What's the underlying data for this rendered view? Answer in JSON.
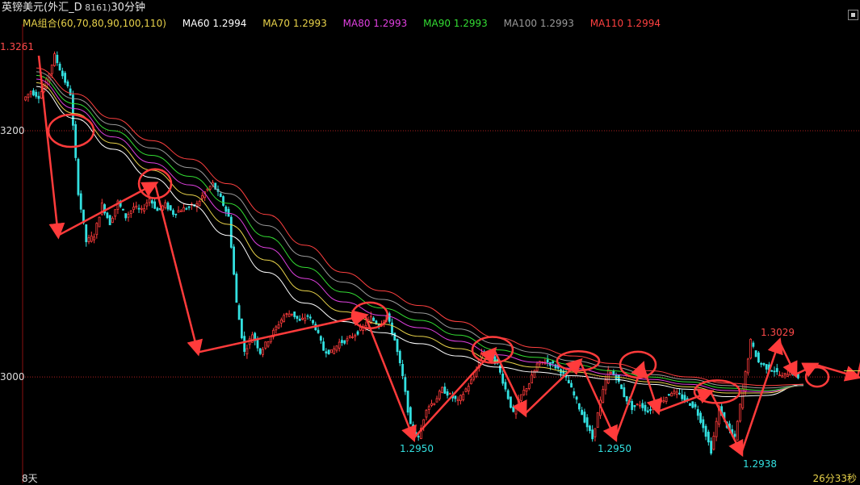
{
  "header": {
    "symbol": "英镑美元",
    "detail": "(外汇_D",
    "code": " 8161)",
    "period": "30分钟"
  },
  "legend": [
    {
      "label": "MA组合(60,70,80,90,100,110)",
      "color": "#e8d24a"
    },
    {
      "label": "MA60 1.2994",
      "color": "#ffffff"
    },
    {
      "label": "MA70 1.2993",
      "color": "#e8d24a"
    },
    {
      "label": "MA80 1.2993",
      "color": "#e040e0"
    },
    {
      "label": "MA90 1.2993",
      "color": "#33dd33"
    },
    {
      "label": "MA100 1.2993",
      "color": "#9a9a9a"
    },
    {
      "label": "MA110 1.2994",
      "color": "#ff4040"
    }
  ],
  "footer": {
    "period_label": "8天",
    "countdown": "26分33秒"
  },
  "chart_data": {
    "type": "candlestick",
    "y_ticks": [
      {
        "value": 1.32,
        "label": "3200"
      },
      {
        "value": 1.3,
        "label": "3000"
      }
    ],
    "ylim": [
      1.2926,
      1.328
    ],
    "annotations": [
      {
        "label": "1.3261",
        "value": 1.3261,
        "color": "#ff4a4a"
      },
      {
        "label": "1.2950",
        "value": 1.295,
        "color": "#33e0e0"
      },
      {
        "label": "1.2950",
        "value": 1.295,
        "color": "#33e0e0"
      },
      {
        "label": "1.3029",
        "value": 1.3029,
        "color": "#ff4a4a"
      },
      {
        "label": "1.2938",
        "value": 1.2938,
        "color": "#33e0e0"
      }
    ],
    "price_path": [
      1.3225,
      1.3232,
      1.3228,
      1.324,
      1.3261,
      1.3245,
      1.323,
      1.315,
      1.311,
      1.3115,
      1.314,
      1.3125,
      1.3142,
      1.313,
      1.3138,
      1.3135,
      1.3145,
      1.3135,
      1.314,
      1.3133,
      1.3136,
      1.3138,
      1.314,
      1.315,
      1.3157,
      1.3145,
      1.313,
      1.306,
      1.302,
      1.3035,
      1.302,
      1.303,
      1.304,
      1.305,
      1.3052,
      1.3045,
      1.305,
      1.304,
      1.3022,
      1.302,
      1.3028,
      1.303,
      1.3035,
      1.304,
      1.3048,
      1.3042,
      1.305,
      1.303,
      1.3,
      1.296,
      1.295,
      1.2975,
      1.298,
      1.299,
      1.2985,
      1.298,
      1.299,
      1.3,
      1.302,
      1.3018,
      1.301,
      1.299,
      1.297,
      1.2985,
      1.2995,
      1.301,
      1.3013,
      1.301,
      1.3005,
      1.2995,
      1.298,
      1.2965,
      1.295,
      1.298,
      1.3005,
      1.3,
      1.2985,
      1.2975,
      1.2978,
      1.2972,
      1.2978,
      1.2982,
      1.2988,
      1.2985,
      1.298,
      1.2975,
      1.296,
      1.294,
      1.2975,
      1.296,
      1.295,
      1.299,
      1.3029,
      1.3012,
      1.3008,
      1.3005,
      1.3,
      1.3005,
      1.3
    ],
    "ma_series": [
      {
        "name": "MA60",
        "color": "#ffffff",
        "values": [
          1.3236,
          1.321,
          1.3185,
          1.3162,
          1.314,
          1.3115,
          1.3085,
          1.306,
          1.3045,
          1.3036,
          1.3027,
          1.3017,
          1.3008,
          1.3004,
          1.3001,
          1.2998,
          1.2994,
          1.299,
          1.2984,
          1.2985,
          1.2994
        ]
      },
      {
        "name": "MA70",
        "color": "#e8d24a",
        "values": [
          1.3239,
          1.3214,
          1.319,
          1.3168,
          1.3148,
          1.3124,
          1.3095,
          1.307,
          1.3053,
          1.3043,
          1.3033,
          1.3023,
          1.3013,
          1.3008,
          1.3004,
          1.3,
          1.2996,
          1.2992,
          1.2987,
          1.2987,
          1.2993
        ]
      },
      {
        "name": "MA80",
        "color": "#e040e0",
        "values": [
          1.3242,
          1.3218,
          1.3195,
          1.3174,
          1.3156,
          1.3133,
          1.3105,
          1.308,
          1.3061,
          1.305,
          1.304,
          1.3029,
          1.3018,
          1.3012,
          1.3007,
          1.3002,
          1.2998,
          1.2994,
          1.2989,
          1.2988,
          1.2993
        ]
      },
      {
        "name": "MA90",
        "color": "#33dd33",
        "values": [
          1.3245,
          1.3222,
          1.32,
          1.318,
          1.3163,
          1.3141,
          1.3114,
          1.3089,
          1.3069,
          1.3056,
          1.3046,
          1.3034,
          1.3022,
          1.3016,
          1.301,
          1.3005,
          1.3,
          1.2996,
          1.2991,
          1.2989,
          1.2993
        ]
      },
      {
        "name": "MA100",
        "color": "#9a9a9a",
        "values": [
          1.3248,
          1.3226,
          1.3205,
          1.3186,
          1.317,
          1.3149,
          1.3123,
          1.3098,
          1.3077,
          1.3063,
          1.3052,
          1.3039,
          1.3027,
          1.302,
          1.3013,
          1.3008,
          1.3002,
          1.2998,
          1.2993,
          1.2991,
          1.2993
        ]
      },
      {
        "name": "MA110",
        "color": "#ff4040",
        "values": [
          1.3251,
          1.323,
          1.321,
          1.3192,
          1.3177,
          1.3157,
          1.3132,
          1.3107,
          1.3085,
          1.307,
          1.3058,
          1.3045,
          1.3032,
          1.3024,
          1.3017,
          1.3011,
          1.3005,
          1.3,
          1.2995,
          1.2993,
          1.2994
        ]
      }
    ],
    "trend_arrows": [
      [
        1.3261,
        1.3115
      ],
      [
        1.3115,
        1.3157
      ],
      [
        1.3157,
        1.302
      ],
      [
        1.302,
        1.305
      ],
      [
        1.305,
        1.295
      ],
      [
        1.295,
        1.3022
      ],
      [
        1.3022,
        1.297
      ],
      [
        1.297,
        1.3013
      ],
      [
        1.3013,
        1.295
      ],
      [
        1.295,
        1.301
      ],
      [
        1.301,
        1.2972
      ],
      [
        1.2972,
        1.2988
      ],
      [
        1.2988,
        1.2938
      ],
      [
        1.2938,
        1.3029
      ],
      [
        1.3029,
        1.3002
      ],
      [
        1.3002,
        1.301
      ],
      [
        1.301,
        1.3
      ],
      [
        1.3,
        1.3115
      ]
    ],
    "highlight_circles": [
      1.32,
      1.3157,
      1.305,
      1.3022,
      1.3013,
      1.301,
      1.2988,
      1.3
    ]
  }
}
